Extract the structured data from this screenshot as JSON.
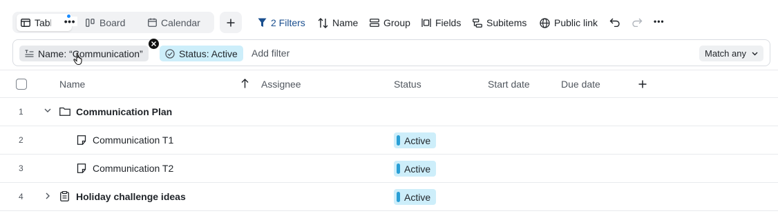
{
  "views": {
    "tabs": [
      {
        "label": "Table",
        "icon": "table-icon"
      },
      {
        "label": "Board",
        "icon": "board-icon"
      },
      {
        "label": "Calendar",
        "icon": "calendar-icon"
      }
    ],
    "add_label": "+"
  },
  "toolbar": {
    "filters_label": "2 Filters",
    "sort_label": "Name",
    "group_label": "Group",
    "fields_label": "Fields",
    "subitems_label": "Subitems",
    "public_link_label": "Public link",
    "more_label": "•••"
  },
  "filter_bar": {
    "name_chip": "Name: “Communication”",
    "status_chip": "Status: Active",
    "add_filter": "Add filter",
    "match_mode": "Match any"
  },
  "table": {
    "columns": [
      "Name",
      "Assignee",
      "Status",
      "Start date",
      "Due date"
    ],
    "sort_direction_icon": "arrow-up-icon",
    "rows": [
      {
        "num": "1",
        "name": "Communication Plan",
        "kind": "folder",
        "status": ""
      },
      {
        "num": "2",
        "name": "Communication T1",
        "kind": "note",
        "status": "Active"
      },
      {
        "num": "3",
        "name": "Communication T2",
        "kind": "note",
        "status": "Active"
      },
      {
        "num": "4",
        "name": "Holiday challenge ideas",
        "kind": "clipboard",
        "status": "Active"
      }
    ]
  },
  "colors": {
    "accent": "#1a8cff",
    "status_active_bg": "#cdeefa",
    "status_active_bar": "#2a9fd6",
    "filters_text": "#1a4f8f"
  }
}
